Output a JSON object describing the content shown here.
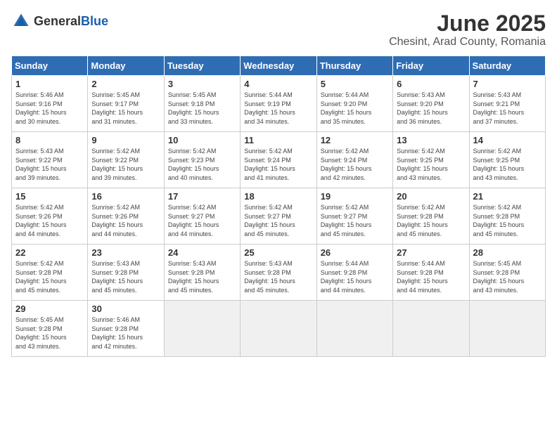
{
  "logo": {
    "general": "General",
    "blue": "Blue"
  },
  "title": "June 2025",
  "location": "Chesint, Arad County, Romania",
  "days_header": [
    "Sunday",
    "Monday",
    "Tuesday",
    "Wednesday",
    "Thursday",
    "Friday",
    "Saturday"
  ],
  "weeks": [
    [
      {
        "day": "1",
        "info": "Sunrise: 5:46 AM\nSunset: 9:16 PM\nDaylight: 15 hours\nand 30 minutes."
      },
      {
        "day": "2",
        "info": "Sunrise: 5:45 AM\nSunset: 9:17 PM\nDaylight: 15 hours\nand 31 minutes."
      },
      {
        "day": "3",
        "info": "Sunrise: 5:45 AM\nSunset: 9:18 PM\nDaylight: 15 hours\nand 33 minutes."
      },
      {
        "day": "4",
        "info": "Sunrise: 5:44 AM\nSunset: 9:19 PM\nDaylight: 15 hours\nand 34 minutes."
      },
      {
        "day": "5",
        "info": "Sunrise: 5:44 AM\nSunset: 9:20 PM\nDaylight: 15 hours\nand 35 minutes."
      },
      {
        "day": "6",
        "info": "Sunrise: 5:43 AM\nSunset: 9:20 PM\nDaylight: 15 hours\nand 36 minutes."
      },
      {
        "day": "7",
        "info": "Sunrise: 5:43 AM\nSunset: 9:21 PM\nDaylight: 15 hours\nand 37 minutes."
      }
    ],
    [
      {
        "day": "8",
        "info": "Sunrise: 5:43 AM\nSunset: 9:22 PM\nDaylight: 15 hours\nand 39 minutes."
      },
      {
        "day": "9",
        "info": "Sunrise: 5:42 AM\nSunset: 9:22 PM\nDaylight: 15 hours\nand 39 minutes."
      },
      {
        "day": "10",
        "info": "Sunrise: 5:42 AM\nSunset: 9:23 PM\nDaylight: 15 hours\nand 40 minutes."
      },
      {
        "day": "11",
        "info": "Sunrise: 5:42 AM\nSunset: 9:24 PM\nDaylight: 15 hours\nand 41 minutes."
      },
      {
        "day": "12",
        "info": "Sunrise: 5:42 AM\nSunset: 9:24 PM\nDaylight: 15 hours\nand 42 minutes."
      },
      {
        "day": "13",
        "info": "Sunrise: 5:42 AM\nSunset: 9:25 PM\nDaylight: 15 hours\nand 43 minutes."
      },
      {
        "day": "14",
        "info": "Sunrise: 5:42 AM\nSunset: 9:25 PM\nDaylight: 15 hours\nand 43 minutes."
      }
    ],
    [
      {
        "day": "15",
        "info": "Sunrise: 5:42 AM\nSunset: 9:26 PM\nDaylight: 15 hours\nand 44 minutes."
      },
      {
        "day": "16",
        "info": "Sunrise: 5:42 AM\nSunset: 9:26 PM\nDaylight: 15 hours\nand 44 minutes."
      },
      {
        "day": "17",
        "info": "Sunrise: 5:42 AM\nSunset: 9:27 PM\nDaylight: 15 hours\nand 44 minutes."
      },
      {
        "day": "18",
        "info": "Sunrise: 5:42 AM\nSunset: 9:27 PM\nDaylight: 15 hours\nand 45 minutes."
      },
      {
        "day": "19",
        "info": "Sunrise: 5:42 AM\nSunset: 9:27 PM\nDaylight: 15 hours\nand 45 minutes."
      },
      {
        "day": "20",
        "info": "Sunrise: 5:42 AM\nSunset: 9:28 PM\nDaylight: 15 hours\nand 45 minutes."
      },
      {
        "day": "21",
        "info": "Sunrise: 5:42 AM\nSunset: 9:28 PM\nDaylight: 15 hours\nand 45 minutes."
      }
    ],
    [
      {
        "day": "22",
        "info": "Sunrise: 5:42 AM\nSunset: 9:28 PM\nDaylight: 15 hours\nand 45 minutes."
      },
      {
        "day": "23",
        "info": "Sunrise: 5:43 AM\nSunset: 9:28 PM\nDaylight: 15 hours\nand 45 minutes."
      },
      {
        "day": "24",
        "info": "Sunrise: 5:43 AM\nSunset: 9:28 PM\nDaylight: 15 hours\nand 45 minutes."
      },
      {
        "day": "25",
        "info": "Sunrise: 5:43 AM\nSunset: 9:28 PM\nDaylight: 15 hours\nand 45 minutes."
      },
      {
        "day": "26",
        "info": "Sunrise: 5:44 AM\nSunset: 9:28 PM\nDaylight: 15 hours\nand 44 minutes."
      },
      {
        "day": "27",
        "info": "Sunrise: 5:44 AM\nSunset: 9:28 PM\nDaylight: 15 hours\nand 44 minutes."
      },
      {
        "day": "28",
        "info": "Sunrise: 5:45 AM\nSunset: 9:28 PM\nDaylight: 15 hours\nand 43 minutes."
      }
    ],
    [
      {
        "day": "29",
        "info": "Sunrise: 5:45 AM\nSunset: 9:28 PM\nDaylight: 15 hours\nand 43 minutes."
      },
      {
        "day": "30",
        "info": "Sunrise: 5:46 AM\nSunset: 9:28 PM\nDaylight: 15 hours\nand 42 minutes."
      },
      {
        "day": "",
        "info": ""
      },
      {
        "day": "",
        "info": ""
      },
      {
        "day": "",
        "info": ""
      },
      {
        "day": "",
        "info": ""
      },
      {
        "day": "",
        "info": ""
      }
    ]
  ]
}
